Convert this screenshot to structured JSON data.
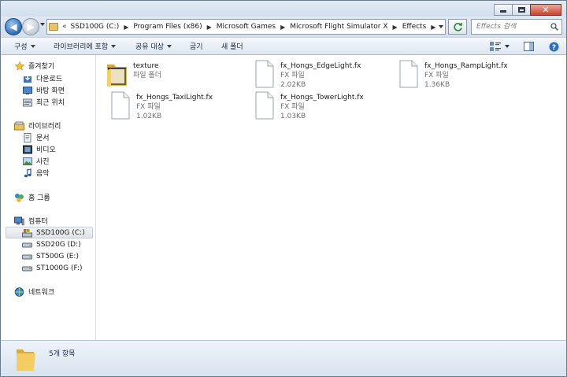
{
  "address": {
    "chevrons": "«",
    "crumbs": [
      "SSD100G (C:)",
      "Program Files (x86)",
      "Microsoft Games",
      "Microsoft Flight Simulator X",
      "Effects"
    ]
  },
  "search": {
    "placeholder": "Effects 검색"
  },
  "toolbar": {
    "organize": "구성",
    "include_in_library": "라이브러리에 포함",
    "share_with": "공유 대상",
    "burn": "굽기",
    "new_folder": "새 폴더"
  },
  "nav": {
    "favorites": "즐겨찾기",
    "downloads": "다운로드",
    "desktop": "바탕 화면",
    "recent": "최근 위치",
    "libraries": "라이브러리",
    "documents": "문서",
    "videos": "비디오",
    "pictures": "사진",
    "music": "음악",
    "homegroup": "홈 그룹",
    "computer": "컴퓨터",
    "drives": [
      "SSD100G (C:)",
      "SSD20G (D:)",
      "ST500G (E:)",
      "ST1000G (F:)"
    ],
    "network": "네트워크"
  },
  "files": [
    {
      "name": "texture",
      "type": "파일 폴더",
      "size": ""
    },
    {
      "name": "fx_Hongs_EdgeLight.fx",
      "type": "FX 파일",
      "size": "2.02KB"
    },
    {
      "name": "fx_Hongs_RampLight.fx",
      "type": "FX 파일",
      "size": "1.36KB"
    },
    {
      "name": "fx_Hongs_TaxiLight.fx",
      "type": "FX 파일",
      "size": "1.02KB"
    },
    {
      "name": "fx_Hongs_TowerLight.fx",
      "type": "FX 파일",
      "size": "1.03KB"
    }
  ],
  "status": {
    "item_count": "5개 항목"
  }
}
